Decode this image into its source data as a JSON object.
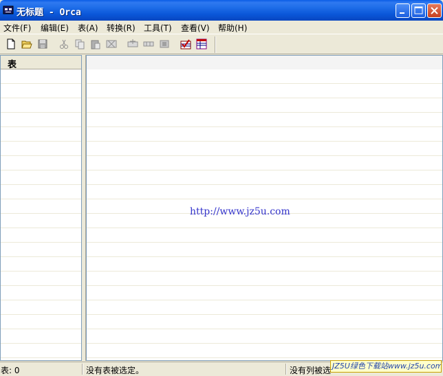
{
  "window": {
    "title": "无标题 - Orca",
    "controls": [
      "minimize-icon",
      "maximize-icon",
      "close-icon"
    ]
  },
  "menu": {
    "items": [
      {
        "label": "文件(F)"
      },
      {
        "label": "编辑(E)"
      },
      {
        "label": "表(A)"
      },
      {
        "label": "转换(R)"
      },
      {
        "label": "工具(T)"
      },
      {
        "label": "查看(V)"
      },
      {
        "label": "帮助(H)"
      }
    ]
  },
  "toolbar": {
    "icons": [
      "new-icon",
      "open-icon",
      "save-icon",
      "cut-icon",
      "copy-icon",
      "paste-icon",
      "drop-row-icon",
      "add-row-icon",
      "row-icon",
      "drop-table-icon",
      "validate-icon",
      "merge-icon"
    ]
  },
  "left_pane": {
    "header": "表"
  },
  "right_pane": {
    "watermark": "http://www.jz5u.com"
  },
  "status": {
    "tables": "表: 0",
    "no_table_selected": "没有表被选定。",
    "no_column_selected": "没有列被选",
    "badge": "JZ5U绿色下载站www.jz5u.com"
  },
  "colors": {
    "titlebar": "#0a5de6",
    "chrome": "#ece9d8",
    "watermark": "#3333cc"
  }
}
